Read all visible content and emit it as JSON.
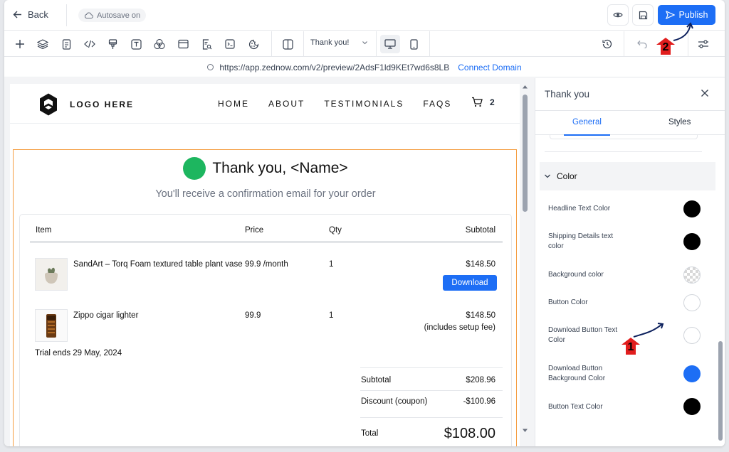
{
  "topbar": {
    "back_label": "Back",
    "autosave_label": "Autosave on",
    "publish_label": "Publish"
  },
  "toolbar": {
    "page_name": "Thank you!"
  },
  "url": {
    "address": "https://app.zednow.com/v2/preview/2AdsF1ld9KEt7wd6s8LB",
    "connect_label": "Connect Domain"
  },
  "site": {
    "logo_text": "LOGO HERE",
    "nav": [
      "HOME",
      "ABOUT",
      "TESTIMONIALS",
      "FAQS"
    ],
    "cart_count": "2",
    "title": "Thank you, <Name>",
    "subtitle": "You'll receive a confirmation email for your order",
    "table": {
      "headers": {
        "item": "Item",
        "price": "Price",
        "qty": "Qty",
        "subtotal": "Subtotal"
      },
      "rows": [
        {
          "name": "SandArt – Torq Foam textured table plant vase",
          "price": "99.9 /month",
          "qty": "1",
          "subtotal": "$148.50",
          "button": "Download"
        },
        {
          "name": "Zippo cigar lighter",
          "price": "99.9",
          "qty": "1",
          "subtotal": "$148.50",
          "note": "(includes setup fee)"
        }
      ],
      "trial_note": "Trial ends 29 May, 2024"
    },
    "summary": {
      "subtotal_label": "Subtotal",
      "subtotal_value": "$208.96",
      "discount_label": "Discount (coupon)",
      "discount_value": "-$100.96",
      "total_label": "Total",
      "total_value": "$108.00"
    }
  },
  "panel": {
    "title": "Thank you",
    "tabs": [
      "General",
      "Styles"
    ],
    "section": "Color",
    "rows": [
      {
        "label": "Headline Text Color",
        "color": "#000000"
      },
      {
        "label": "Shipping Details text color",
        "color": "#000000"
      },
      {
        "label": "Background color",
        "color": "transparent"
      },
      {
        "label": "Button Color",
        "color": "#ffffff"
      },
      {
        "label": "Download Button Text Color",
        "color": "#ffffff"
      },
      {
        "label": "Download Button Background Color",
        "color": "#1d6ef5"
      },
      {
        "label": "Button Text Color",
        "color": "#000000"
      }
    ]
  },
  "annotations": {
    "marker1": "1",
    "marker2": "2"
  },
  "colors": {
    "accent": "#1d6ef5",
    "success": "#1db65f",
    "highlight": "#f59e42",
    "marker": "#e11d1d"
  }
}
